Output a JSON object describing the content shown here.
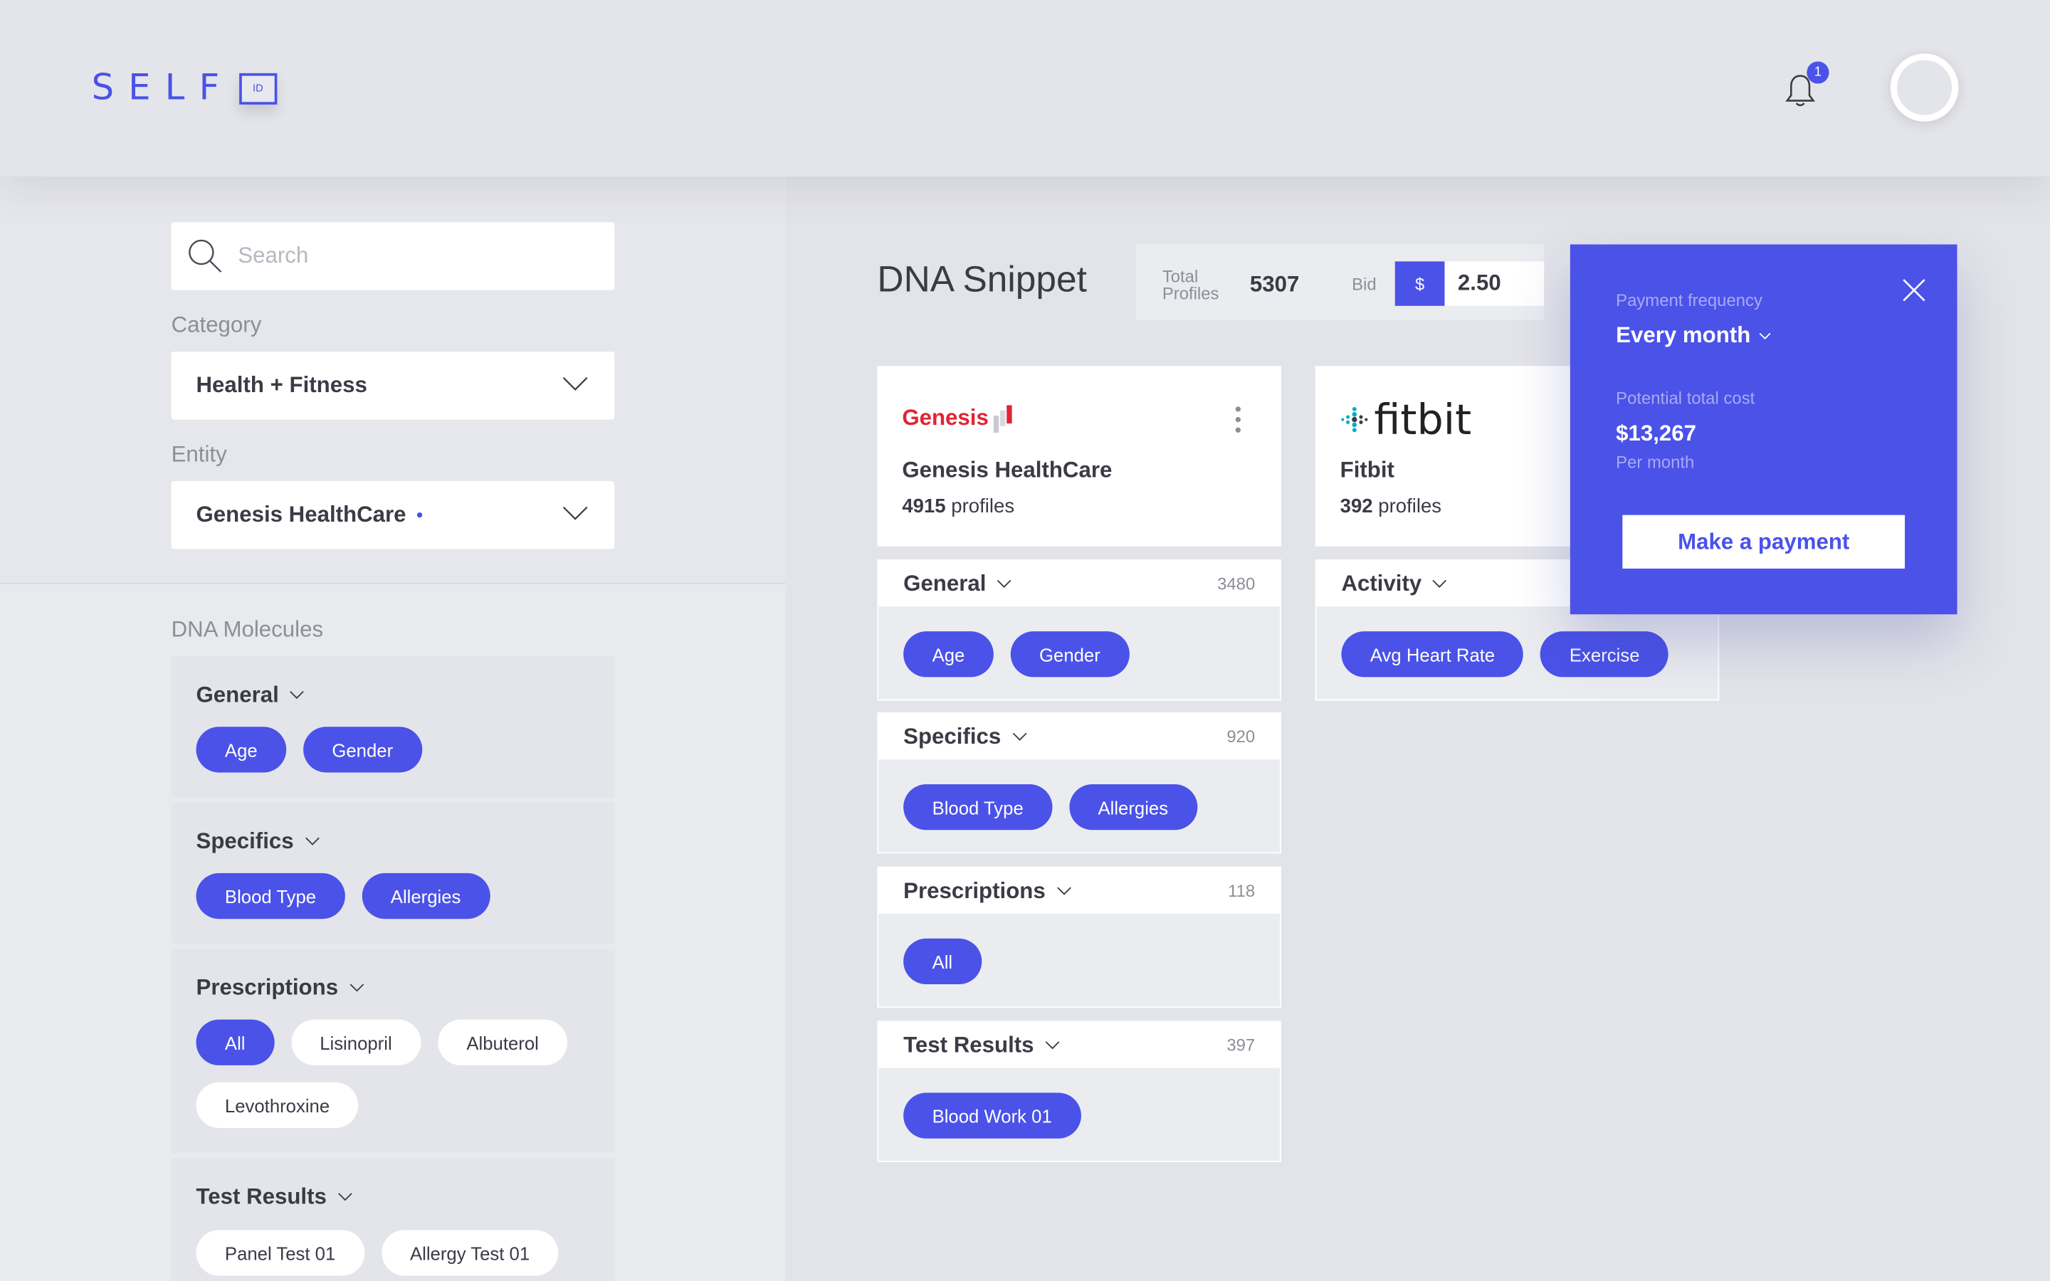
{
  "app": {
    "logo_text": "SELF",
    "logo_badge": "ID"
  },
  "header": {
    "notification_count": "1"
  },
  "sidebar": {
    "search_placeholder": "Search",
    "category_label": "Category",
    "category_value": "Health + Fitness",
    "entity_label": "Entity",
    "entity_value": "Genesis HealthCare",
    "molecules_title": "DNA Molecules",
    "groups": [
      {
        "title": "General",
        "chips": [
          "Age",
          "Gender"
        ]
      },
      {
        "title": "Specifics",
        "chips": [
          "Blood Type",
          "Allergies"
        ]
      },
      {
        "title": "Prescriptions",
        "chips": [
          "All",
          "Lisinopril",
          "Albuterol",
          "Levothroxine"
        ]
      },
      {
        "title": "Test Results",
        "chips": [
          "Panel Test 01",
          "Allergy Test 01"
        ]
      }
    ]
  },
  "main": {
    "title": "DNA Snippet",
    "total_profiles_label_1": "Total",
    "total_profiles_label_2": "Profiles",
    "total_profiles": "5307",
    "bid_label": "Bid",
    "bid_currency": "$",
    "bid_value": "2.50"
  },
  "entities": [
    {
      "logo": "Genesis",
      "name": "Genesis HealthCare",
      "profiles_count": "4915",
      "profiles_suffix": " profiles",
      "categories": [
        {
          "title": "General",
          "count": "3480",
          "chips": [
            "Age",
            "Gender"
          ]
        },
        {
          "title": "Specifics",
          "count": "920",
          "chips": [
            "Blood Type",
            "Allergies"
          ]
        },
        {
          "title": "Prescriptions",
          "count": "118",
          "chips": [
            "All"
          ]
        },
        {
          "title": "Test Results",
          "count": "397",
          "chips": [
            "Blood Work 01"
          ]
        }
      ]
    },
    {
      "logo": "fitbit",
      "name": "Fitbit",
      "profiles_count": "392",
      "profiles_suffix": " profiles",
      "categories": [
        {
          "title": "Activity",
          "chips": [
            "Avg Heart Rate",
            "Exercise"
          ]
        }
      ]
    }
  ],
  "payment_popup": {
    "frequency_label": "Payment frequency",
    "frequency_value": "Every month",
    "cost_label": "Potential total cost",
    "cost_value": "$13,267",
    "cost_period": "Per month",
    "button_label": "Make a payment"
  },
  "colors": {
    "accent": "#4a52e8",
    "background": "#e6e7ec",
    "card": "#ffffff"
  }
}
